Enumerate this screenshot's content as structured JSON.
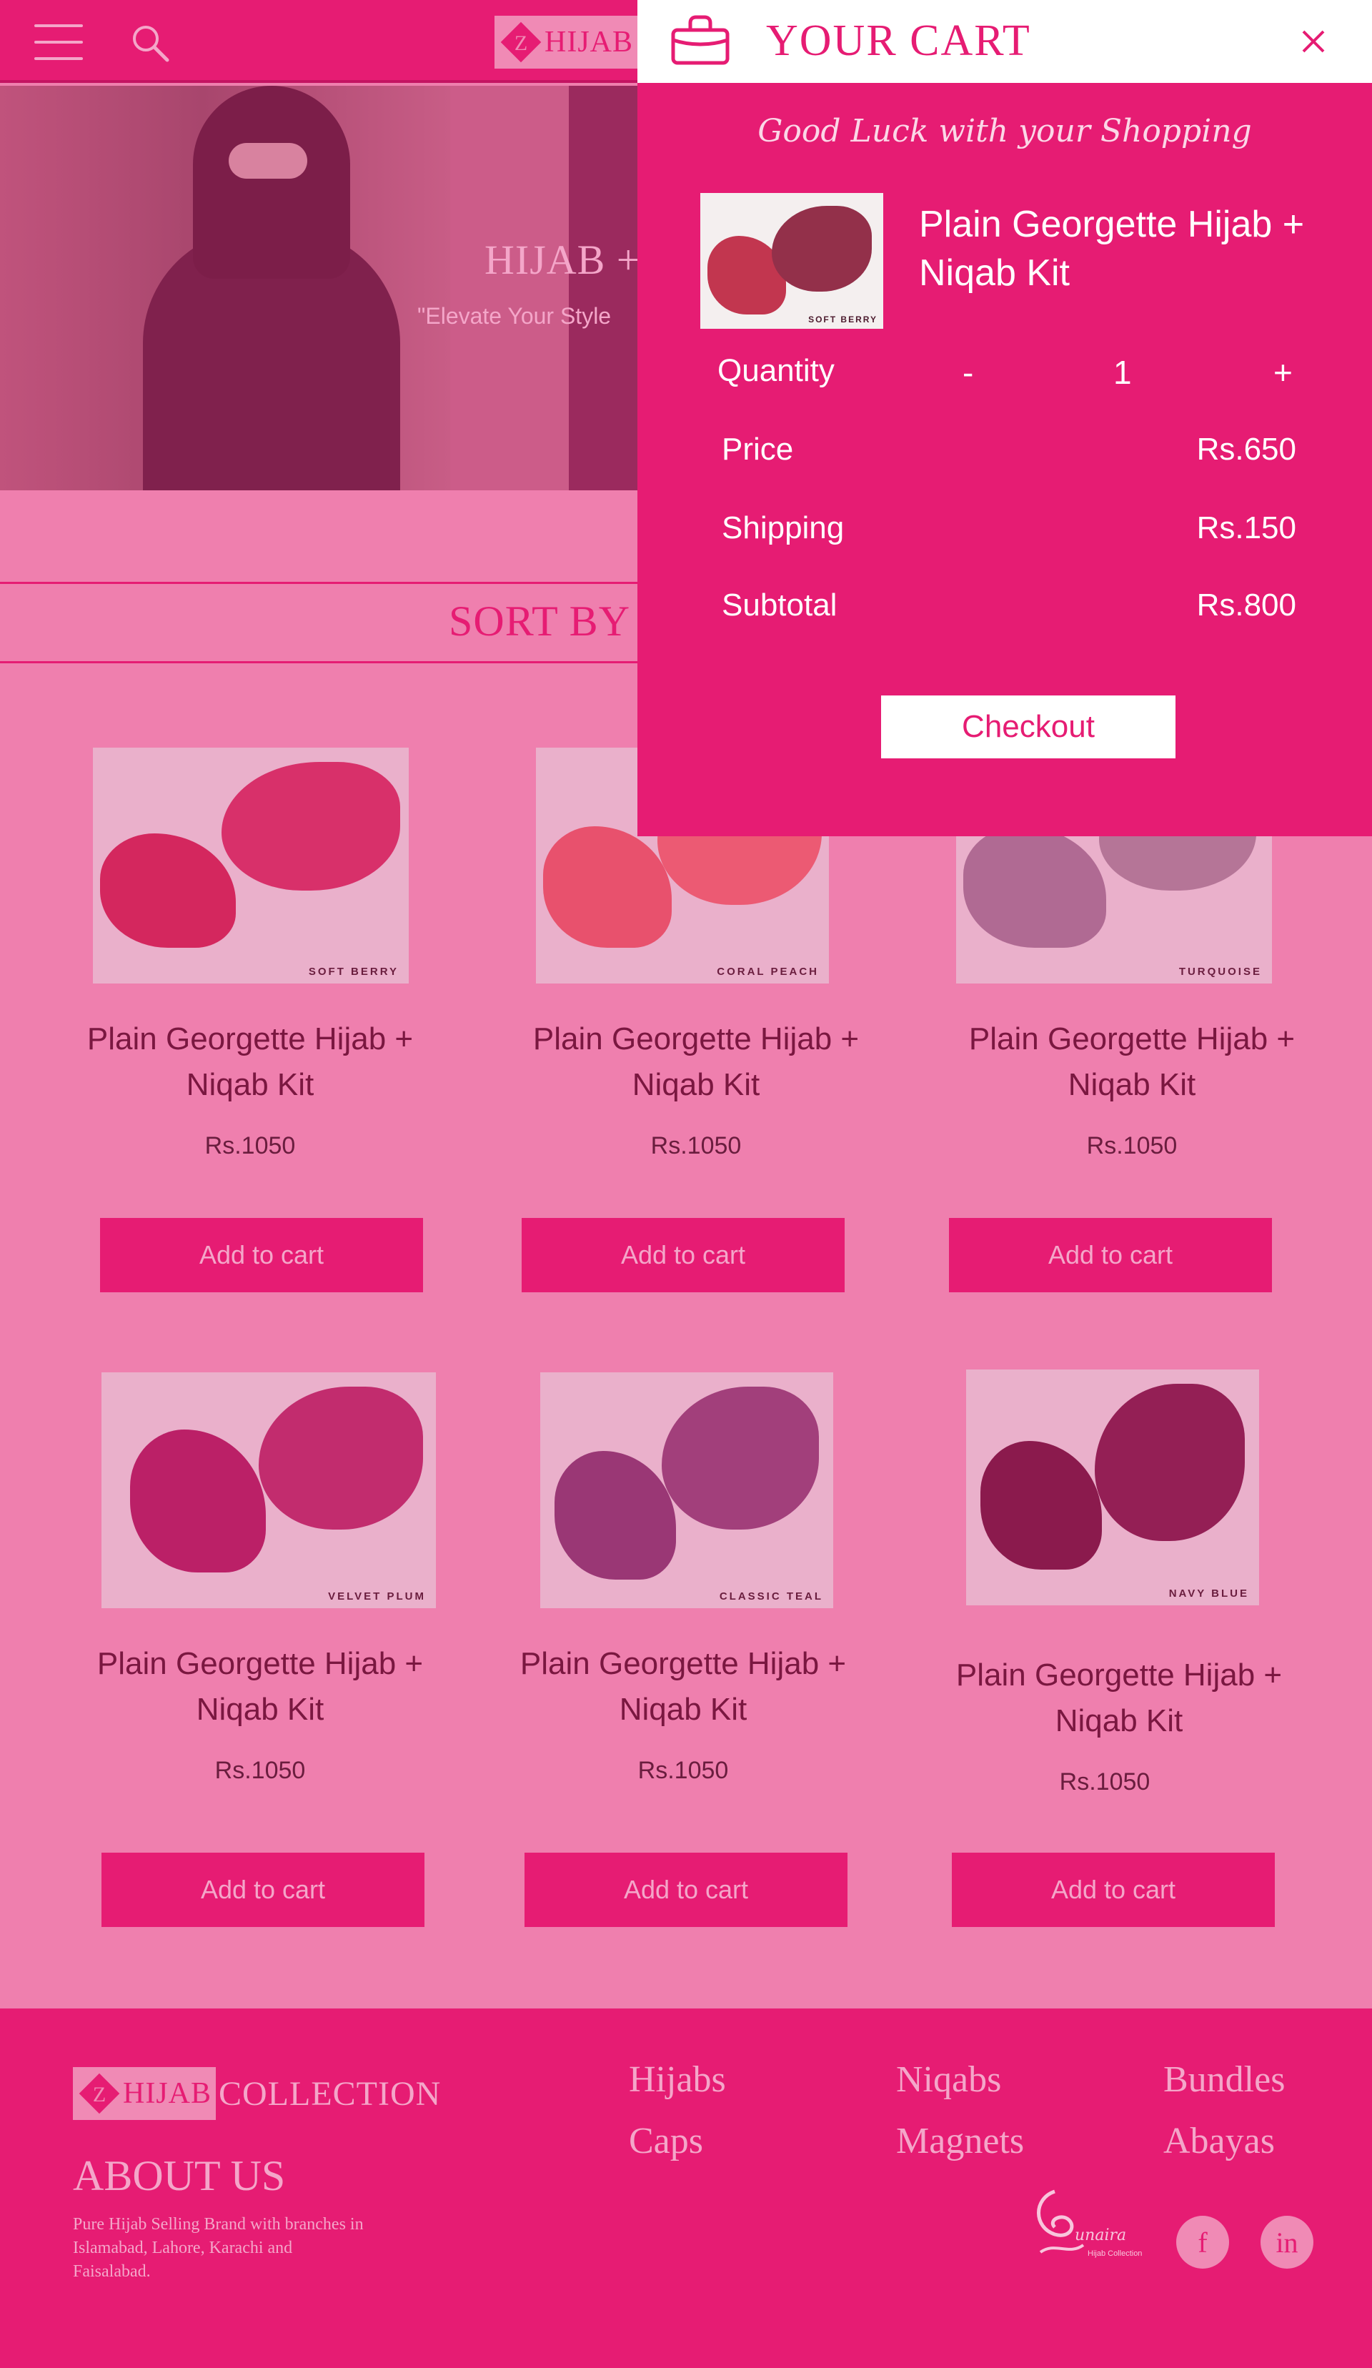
{
  "header": {
    "logo_text": "HIJAB"
  },
  "hero": {
    "title": "HIJAB +",
    "subtitle": "\"Elevate Your Style"
  },
  "sort": {
    "label": "SORT BY"
  },
  "products": [
    {
      "name": "Plain Georgette Hijab + Niqab Kit",
      "price": "Rs.1050",
      "tag": "SOFT BERRY",
      "button": "Add to cart",
      "colors": [
        "#d4275e",
        "#d8306a"
      ]
    },
    {
      "name": "Plain Georgette Hijab + Niqab Kit",
      "price": "Rs.1050",
      "tag": "CORAL PEACH",
      "button": "Add to cart",
      "colors": [
        "#e8516d",
        "#ec5a73"
      ]
    },
    {
      "name": "Plain Georgette Hijab + Niqab Kit",
      "price": "Rs.1050",
      "tag": "TURQUOISE",
      "button": "Add to cart",
      "colors": [
        "#b06a93",
        "#b57597"
      ]
    },
    {
      "name": "Plain Georgette Hijab + Niqab Kit",
      "price": "Rs.1050",
      "tag": "VELVET PLUM",
      "button": "Add to cart",
      "colors": [
        "#bb2067",
        "#c22c6e"
      ]
    },
    {
      "name": "Plain Georgette Hijab + Niqab Kit",
      "price": "Rs.1050",
      "tag": "CLASSIC TEAL",
      "button": "Add to cart",
      "colors": [
        "#9a3775",
        "#a23f7b"
      ]
    },
    {
      "name": "Plain Georgette Hijab + Niqab Kit",
      "price": "Rs.1050",
      "tag": "NAVY BLUE",
      "button": "Add to cart",
      "colors": [
        "#8b1a4d",
        "#941f55"
      ]
    }
  ],
  "footer": {
    "logo_text": "HIJAB",
    "collection": "COLLECTION",
    "about_title": "ABOUT US",
    "about_text": "Pure Hijab Selling Brand with branches in Islamabad, Lahore, Karachi and Faisalabad.",
    "links": [
      "Hijabs",
      "Caps",
      "Niqabs",
      "Magnets",
      "Bundles",
      "Abayas"
    ],
    "brand_sub": "Hijab Collection",
    "social": [
      "f",
      "in"
    ]
  },
  "cart": {
    "title": "YOUR CART",
    "greeting": "Good Luck with your Shopping",
    "item": {
      "name": "Plain Georgette Hijab + Niqab Kit",
      "tag": "SOFT BERRY"
    },
    "quantity_label": "Quantity",
    "minus": "-",
    "quantity": "1",
    "plus": "+",
    "price_label": "Price",
    "price": "Rs.650",
    "shipping_label": "Shipping",
    "shipping": "Rs.150",
    "subtotal_label": "Subtotal",
    "subtotal": "Rs.800",
    "checkout": "Checkout"
  },
  "colors": {
    "accent": "#e61c73",
    "page_bg": "#ef7fae",
    "pale": "#f4a6c9",
    "text_dark": "#7a1740"
  }
}
